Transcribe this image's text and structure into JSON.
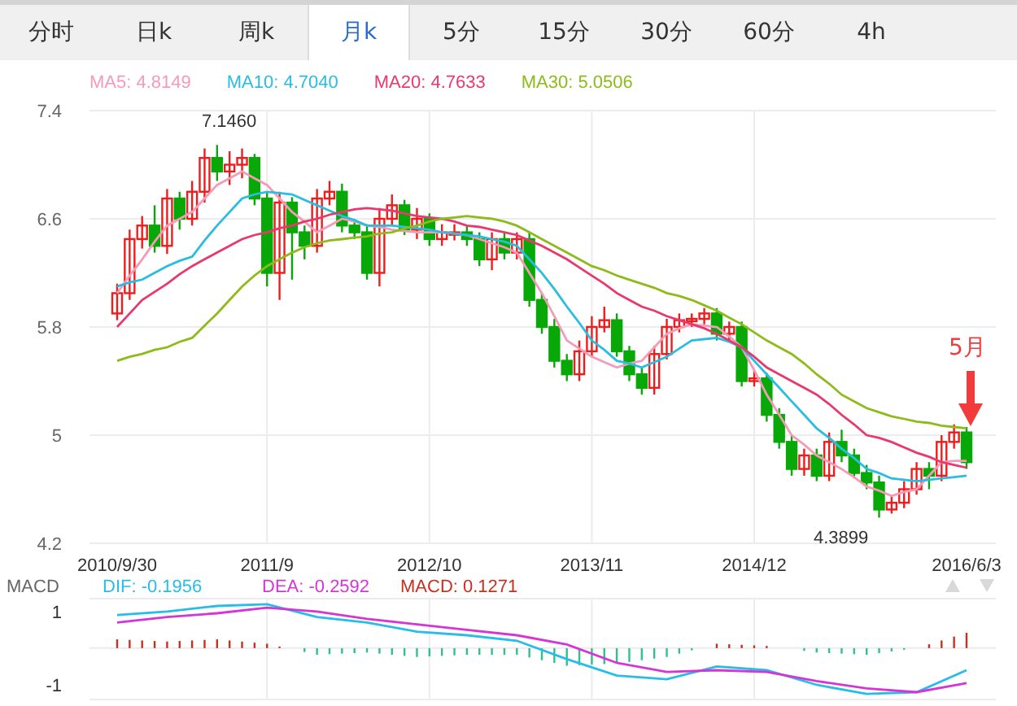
{
  "tabs": [
    {
      "label": "分时",
      "selected": false
    },
    {
      "label": "日k",
      "selected": false
    },
    {
      "label": "周k",
      "selected": false
    },
    {
      "label": "月k",
      "selected": true
    },
    {
      "label": "5分",
      "selected": false
    },
    {
      "label": "15分",
      "selected": false
    },
    {
      "label": "30分",
      "selected": false
    },
    {
      "label": "60分",
      "selected": false
    },
    {
      "label": "4h",
      "selected": false
    }
  ],
  "price_chart": {
    "high_label": "7.1460",
    "low_label": "4.3899",
    "marker_label": "5月",
    "chart_data": {
      "type": "candlestick",
      "categories": [
        "2010/9/30",
        null,
        null,
        null,
        null,
        null,
        null,
        null,
        null,
        null,
        null,
        null,
        "2011/9",
        null,
        null,
        null,
        null,
        null,
        null,
        null,
        null,
        null,
        null,
        null,
        null,
        "2012/10",
        null,
        null,
        null,
        null,
        null,
        null,
        null,
        null,
        null,
        null,
        null,
        null,
        "2013/11",
        null,
        null,
        null,
        null,
        null,
        null,
        null,
        null,
        null,
        null,
        null,
        null,
        "2014/12",
        null,
        null,
        null,
        null,
        null,
        null,
        null,
        null,
        null,
        null,
        null,
        null,
        null,
        null,
        null,
        null,
        "2016/6/3"
      ],
      "ylim": [
        4.2,
        7.4
      ],
      "grid": true,
      "yticks": [
        7.4,
        6.6,
        5.8,
        5,
        4.2
      ],
      "ohlc": [
        [
          5.9,
          6.12,
          5.85,
          6.05
        ],
        [
          6.05,
          6.52,
          6.0,
          6.45
        ],
        [
          6.45,
          6.62,
          6.38,
          6.55
        ],
        [
          6.55,
          6.7,
          6.35,
          6.4
        ],
        [
          6.4,
          6.82,
          6.34,
          6.75
        ],
        [
          6.75,
          6.8,
          6.52,
          6.6
        ],
        [
          6.6,
          6.88,
          6.55,
          6.8
        ],
        [
          6.8,
          7.12,
          6.72,
          7.05
        ],
        [
          7.05,
          7.146,
          6.88,
          6.95
        ],
        [
          6.95,
          7.1,
          6.85,
          7.0
        ],
        [
          7.0,
          7.12,
          6.9,
          7.05
        ],
        [
          7.05,
          7.08,
          6.7,
          6.75
        ],
        [
          6.75,
          6.8,
          6.1,
          6.2
        ],
        [
          6.2,
          6.8,
          6.0,
          6.72
        ],
        [
          6.72,
          6.76,
          6.15,
          6.5
        ],
        [
          6.5,
          6.55,
          6.3,
          6.4
        ],
        [
          6.4,
          6.82,
          6.35,
          6.75
        ],
        [
          6.75,
          6.88,
          6.7,
          6.8
        ],
        [
          6.8,
          6.86,
          6.5,
          6.55
        ],
        [
          6.55,
          6.6,
          6.45,
          6.5
        ],
        [
          6.5,
          6.56,
          6.15,
          6.2
        ],
        [
          6.2,
          6.68,
          6.1,
          6.6
        ],
        [
          6.6,
          6.78,
          6.55,
          6.7
        ],
        [
          6.7,
          6.74,
          6.48,
          6.52
        ],
        [
          6.52,
          6.68,
          6.45,
          6.6
        ],
        [
          6.6,
          6.64,
          6.4,
          6.45
        ],
        [
          6.45,
          6.56,
          6.4,
          6.5
        ],
        [
          6.5,
          6.56,
          6.44,
          6.5
        ],
        [
          6.5,
          6.55,
          6.4,
          6.45
        ],
        [
          6.45,
          6.5,
          6.25,
          6.3
        ],
        [
          6.3,
          6.5,
          6.22,
          6.45
        ],
        [
          6.45,
          6.5,
          6.3,
          6.35
        ],
        [
          6.35,
          6.5,
          6.3,
          6.45
        ],
        [
          6.45,
          6.5,
          5.95,
          6.0
        ],
        [
          6.0,
          6.05,
          5.75,
          5.8
        ],
        [
          5.8,
          5.86,
          5.5,
          5.55
        ],
        [
          5.55,
          5.6,
          5.4,
          5.45
        ],
        [
          5.45,
          5.7,
          5.4,
          5.62
        ],
        [
          5.62,
          5.88,
          5.58,
          5.8
        ],
        [
          5.8,
          5.95,
          5.76,
          5.85
        ],
        [
          5.85,
          5.9,
          5.58,
          5.62
        ],
        [
          5.62,
          5.66,
          5.4,
          5.45
        ],
        [
          5.45,
          5.5,
          5.3,
          5.35
        ],
        [
          5.35,
          5.66,
          5.3,
          5.6
        ],
        [
          5.6,
          5.86,
          5.56,
          5.8
        ],
        [
          5.8,
          5.9,
          5.76,
          5.85
        ],
        [
          5.85,
          5.9,
          5.8,
          5.86
        ],
        [
          5.86,
          5.94,
          5.82,
          5.9
        ],
        [
          5.9,
          5.94,
          5.7,
          5.75
        ],
        [
          5.75,
          5.84,
          5.7,
          5.8
        ],
        [
          5.8,
          5.84,
          5.36,
          5.4
        ],
        [
          5.4,
          5.48,
          5.36,
          5.42
        ],
        [
          5.42,
          5.46,
          5.1,
          5.15
        ],
        [
          5.15,
          5.2,
          4.9,
          4.95
        ],
        [
          4.95,
          5.0,
          4.7,
          4.75
        ],
        [
          4.75,
          4.9,
          4.7,
          4.85
        ],
        [
          4.85,
          4.9,
          4.66,
          4.7
        ],
        [
          4.7,
          5.02,
          4.66,
          4.95
        ],
        [
          4.95,
          5.04,
          4.8,
          4.85
        ],
        [
          4.85,
          4.9,
          4.68,
          4.72
        ],
        [
          4.72,
          4.78,
          4.6,
          4.65
        ],
        [
          4.65,
          4.7,
          4.3899,
          4.45
        ],
        [
          4.45,
          4.56,
          4.42,
          4.5
        ],
        [
          4.5,
          4.66,
          4.46,
          4.6
        ],
        [
          4.6,
          4.8,
          4.56,
          4.75
        ],
        [
          4.75,
          4.8,
          4.6,
          4.7
        ],
        [
          4.7,
          5.0,
          4.66,
          4.95
        ],
        [
          4.95,
          5.08,
          4.9,
          5.02
        ],
        [
          5.02,
          5.06,
          4.75,
          4.8
        ]
      ],
      "series": [
        {
          "name": "MA5: 4.8149",
          "type": "line",
          "color": "#f59bb8",
          "values": [
            6.05,
            6.18,
            6.3,
            6.43,
            6.55,
            6.6,
            6.65,
            6.75,
            6.85,
            6.9,
            6.95,
            6.9,
            6.85,
            6.75,
            6.65,
            6.58,
            6.5,
            6.55,
            6.6,
            6.58,
            6.55,
            6.54,
            6.52,
            6.51,
            6.5,
            6.5,
            6.5,
            6.49,
            6.48,
            6.45,
            6.42,
            6.39,
            6.35,
            6.2,
            6.05,
            5.88,
            5.7,
            5.64,
            5.58,
            5.54,
            5.5,
            5.53,
            5.55,
            5.65,
            5.75,
            5.79,
            5.82,
            5.81,
            5.8,
            5.73,
            5.65,
            5.48,
            5.3,
            5.15,
            5.0,
            4.93,
            4.85,
            4.8,
            4.75,
            4.69,
            4.62,
            4.59,
            4.55,
            4.58,
            4.6,
            4.7,
            4.8,
            4.81,
            4.81
          ]
        },
        {
          "name": "MA10: 4.7040",
          "type": "line",
          "color": "#29bde0",
          "values": [
            6.1,
            6.13,
            6.15,
            6.2,
            6.25,
            6.29,
            6.32,
            6.44,
            6.55,
            6.65,
            6.75,
            6.78,
            6.8,
            6.79,
            6.78,
            6.74,
            6.7,
            6.66,
            6.62,
            6.59,
            6.55,
            6.55,
            6.55,
            6.54,
            6.53,
            6.52,
            6.5,
            6.49,
            6.48,
            6.47,
            6.45,
            6.43,
            6.4,
            6.3,
            6.2,
            6.08,
            5.95,
            5.83,
            5.7,
            5.63,
            5.55,
            5.53,
            5.5,
            5.54,
            5.58,
            5.64,
            5.7,
            5.71,
            5.72,
            5.69,
            5.65,
            5.55,
            5.45,
            5.35,
            5.25,
            5.15,
            5.05,
            4.98,
            4.9,
            4.83,
            4.75,
            4.72,
            4.68,
            4.67,
            4.66,
            4.67,
            4.68,
            4.69,
            4.7
          ]
        },
        {
          "name": "MA20: 4.7633",
          "type": "line",
          "color": "#e8396e",
          "values": [
            5.8,
            5.9,
            6.0,
            6.06,
            6.12,
            6.19,
            6.25,
            6.3,
            6.35,
            6.4,
            6.45,
            6.48,
            6.5,
            6.53,
            6.55,
            6.58,
            6.6,
            6.63,
            6.65,
            6.67,
            6.68,
            6.67,
            6.66,
            6.64,
            6.62,
            6.61,
            6.6,
            6.58,
            6.55,
            6.54,
            6.52,
            6.5,
            6.48,
            6.44,
            6.4,
            6.35,
            6.3,
            6.24,
            6.18,
            6.12,
            6.05,
            6.0,
            5.95,
            5.92,
            5.88,
            5.85,
            5.82,
            5.79,
            5.75,
            5.7,
            5.65,
            5.58,
            5.5,
            5.45,
            5.4,
            5.35,
            5.3,
            5.23,
            5.15,
            5.08,
            5.0,
            4.98,
            4.95,
            4.91,
            4.87,
            4.84,
            4.8,
            4.78,
            4.76
          ]
        },
        {
          "name": "MA30: 5.0506",
          "type": "line",
          "color": "#8dbb19",
          "values": [
            5.55,
            5.58,
            5.6,
            5.63,
            5.65,
            5.69,
            5.72,
            5.81,
            5.9,
            6.0,
            6.1,
            6.18,
            6.25,
            6.3,
            6.35,
            6.39,
            6.42,
            6.44,
            6.45,
            6.46,
            6.47,
            6.49,
            6.5,
            6.53,
            6.55,
            6.58,
            6.6,
            6.61,
            6.62,
            6.61,
            6.6,
            6.58,
            6.55,
            6.5,
            6.45,
            6.4,
            6.35,
            6.3,
            6.25,
            6.22,
            6.18,
            6.15,
            6.12,
            6.09,
            6.05,
            6.03,
            6.0,
            5.96,
            5.92,
            5.87,
            5.82,
            5.76,
            5.7,
            5.65,
            5.6,
            5.53,
            5.45,
            5.38,
            5.3,
            5.25,
            5.2,
            5.17,
            5.14,
            5.12,
            5.1,
            5.09,
            5.07,
            5.06,
            5.05
          ]
        }
      ]
    }
  },
  "macd": {
    "title": "MACD",
    "histogram": {
      "label": "MACD: 0.1271",
      "color": "#c8301f"
    },
    "chart_data": {
      "type": "line",
      "grid": true,
      "ylim": [
        -1.4,
        1.35
      ],
      "yticks": [
        1,
        -1
      ],
      "series": [
        {
          "name": "DIF: -0.1956",
          "color": "#27bde8",
          "values": [
            0.9,
            1.0,
            1.15,
            1.2,
            0.85,
            0.7,
            0.45,
            0.35,
            0.2,
            -0.3,
            -0.75,
            -0.85,
            -0.5,
            -0.6,
            -1.0,
            -1.25,
            -1.2,
            -0.6
          ]
        },
        {
          "name": "DEA: -0.2592",
          "color": "#d535d5",
          "values": [
            0.7,
            0.85,
            0.95,
            1.1,
            1.0,
            0.8,
            0.65,
            0.5,
            0.35,
            0.1,
            -0.4,
            -0.65,
            -0.6,
            -0.65,
            -0.9,
            -1.1,
            -1.2,
            -0.95
          ]
        }
      ]
    }
  }
}
